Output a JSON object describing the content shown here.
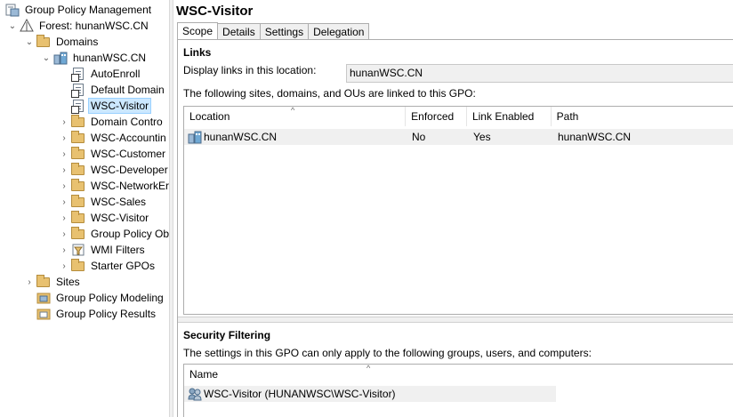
{
  "tree": {
    "root_label": "Group Policy Management",
    "forest_label": "Forest: hunanWSC.CN",
    "domains_label": "Domains",
    "domain_label": "hunanWSC.CN",
    "items": [
      {
        "label": "AutoEnroll",
        "kind": "gpo-link"
      },
      {
        "label": "Default Domain",
        "kind": "gpo-link"
      },
      {
        "label": "WSC-Visitor",
        "kind": "gpo-link",
        "selected": true
      },
      {
        "label": "Domain Contro",
        "kind": "ou"
      },
      {
        "label": "WSC-Accountin",
        "kind": "ou"
      },
      {
        "label": "WSC-Customer",
        "kind": "ou"
      },
      {
        "label": "WSC-Developer",
        "kind": "ou"
      },
      {
        "label": "WSC-NetworkEr",
        "kind": "ou"
      },
      {
        "label": "WSC-Sales",
        "kind": "ou"
      },
      {
        "label": "WSC-Visitor",
        "kind": "ou"
      },
      {
        "label": "Group Policy Ob",
        "kind": "folder"
      },
      {
        "label": "WMI Filters",
        "kind": "folder"
      },
      {
        "label": "Starter GPOs",
        "kind": "folder"
      }
    ],
    "sites_label": "Sites",
    "modeling_label": "Group Policy Modeling",
    "results_label": "Group Policy Results"
  },
  "gpo": {
    "title": "WSC-Visitor",
    "tabs": [
      "Scope",
      "Details",
      "Settings",
      "Delegation"
    ],
    "active_tab": "Scope"
  },
  "links": {
    "heading": "Links",
    "display_label": "Display links in this location:",
    "location_value": "hunanWSC.CN",
    "description": "The following sites, domains, and OUs are linked to this GPO:",
    "columns": [
      "Location",
      "Enforced",
      "Link Enabled",
      "Path"
    ],
    "rows": [
      {
        "location": "hunanWSC.CN",
        "enforced": "No",
        "link_enabled": "Yes",
        "path": "hunanWSC.CN"
      }
    ]
  },
  "security": {
    "heading": "Security Filtering",
    "description": "The settings in this GPO can only apply to the following groups, users, and computers:",
    "columns": [
      "Name"
    ],
    "rows": [
      {
        "name": "WSC-Visitor (HUNANWSC\\WSC-Visitor)"
      }
    ]
  },
  "colors": {
    "selection": "#cce8ff",
    "folder": "#e8c170",
    "row_bg": "#f0f0f0"
  }
}
